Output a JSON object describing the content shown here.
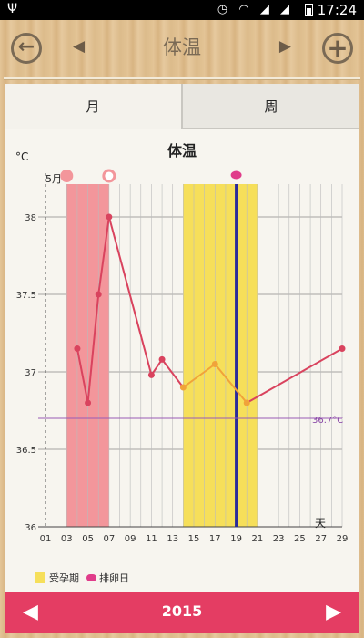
{
  "status_bar": {
    "usb_icon": "usb-icon",
    "time": "17:24"
  },
  "header": {
    "title": "体温",
    "back_icon": "arrow-left-icon",
    "add_icon": "plus-icon",
    "prev_glyph": "◀",
    "next_glyph": "▶",
    "add_glyph": "+",
    "back_glyph": "←"
  },
  "tabs": [
    {
      "label": "月"
    },
    {
      "label": "周"
    }
  ],
  "chart": {
    "title": "体温",
    "unit": "°C",
    "month_label": "5月",
    "x_unit_label": "天",
    "reference_label": "36.7°C"
  },
  "legend": {
    "fertile_label": "受孕期",
    "ovulation_label": "排卵日"
  },
  "footer": {
    "year": "2015",
    "prev_glyph": "◀",
    "next_glyph": "▶"
  },
  "colors": {
    "period": "#f3969b",
    "fertile": "#f6df5a",
    "ovulation_line": "#2b2b9a",
    "line": "#d9435e",
    "fertile_line": "#f0a33a",
    "reference": "#9a5ab4",
    "year_bar": "#e43d63"
  },
  "chart_data": {
    "type": "line",
    "x_ticks": [
      "01",
      "03",
      "05",
      "07",
      "09",
      "11",
      "13",
      "15",
      "17",
      "19",
      "21",
      "23",
      "25",
      "27",
      "29"
    ],
    "y_ticks": [
      "36",
      "36.5",
      "37",
      "37.5",
      "38"
    ],
    "xlim": [
      1,
      29
    ],
    "ylim": [
      36,
      38.2
    ],
    "series": [
      {
        "points": [
          [
            4,
            37.15
          ],
          [
            5,
            36.8
          ],
          [
            6,
            37.5
          ],
          [
            7,
            38.0
          ],
          [
            11,
            36.98
          ],
          [
            12,
            37.08
          ],
          [
            14,
            36.9
          ],
          [
            17,
            37.05
          ],
          [
            20,
            36.8
          ],
          [
            29,
            37.15
          ]
        ]
      }
    ],
    "reference_value": 36.7,
    "period_range": [
      3,
      7
    ],
    "fertile_range": [
      14,
      21
    ],
    "ovulation_day": 19,
    "period_markers": [
      3,
      7
    ]
  }
}
